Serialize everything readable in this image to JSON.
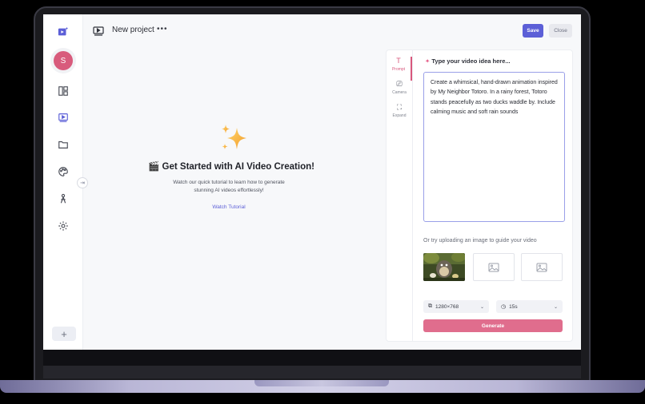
{
  "topbar": {
    "project_title": "New project",
    "more_label": "•••",
    "save_label": "Save",
    "close_label": "Close"
  },
  "sidebar": {
    "avatar_initial": "S",
    "add_label": "+",
    "handle_label": "⇥",
    "items": [
      "video-add-icon",
      "layout-icon",
      "video-icon",
      "folder-icon",
      "palette-icon",
      "person-icon",
      "gear-icon"
    ]
  },
  "hero": {
    "title": "🎬 Get Started with AI Video Creation!",
    "description": "Watch our quick tutorial to learn how to generate stunning AI videos effortlessly!",
    "link": "Watch Tutorial"
  },
  "panel": {
    "tabs": [
      {
        "icon": "T",
        "label": "Prompt"
      },
      {
        "icon": "⎚",
        "label": "Camera"
      },
      {
        "icon": "⛶",
        "label": "Expand"
      }
    ],
    "prompt_heading": "Type your video idea here...",
    "prompt_text": "Create a whimsical, hand-drawn animation inspired by My Neighbor Totoro. In a rainy forest, Totoro stands peacefully as two ducks waddle by. Include calming music and soft rain sounds",
    "upload_label": "Or try uploading an image to guide your video",
    "resolution": "1280×768",
    "duration": "15s",
    "generate_label": "Generate"
  },
  "colors": {
    "accent": "#5c5fd7",
    "pink": "#e06d8d",
    "avatar": "#d85b7c"
  }
}
